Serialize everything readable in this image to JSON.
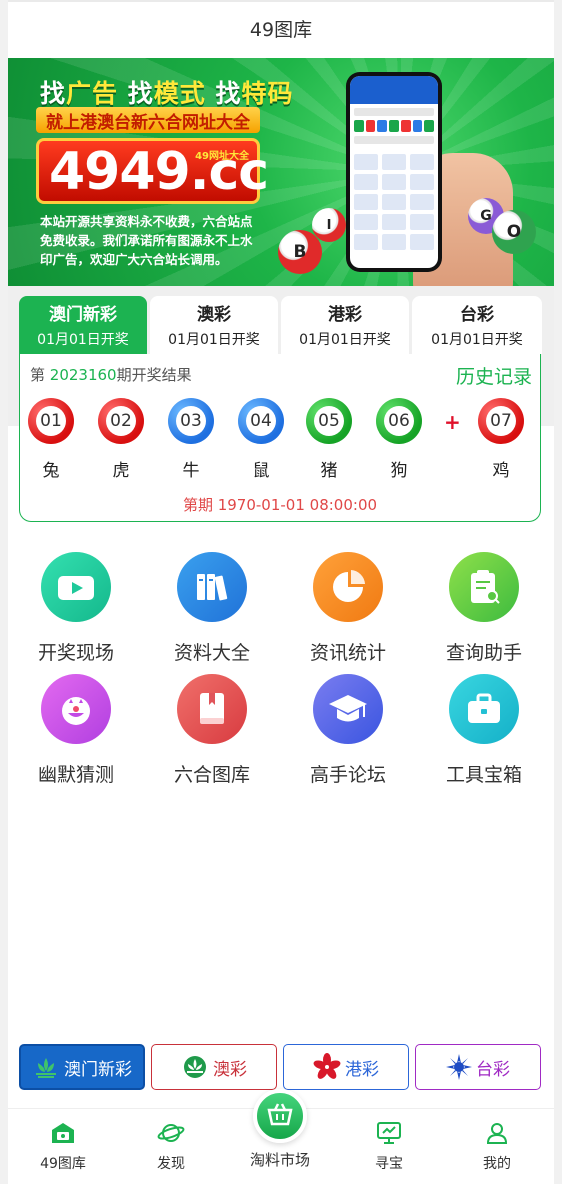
{
  "header": {
    "title": "49图库"
  },
  "banner": {
    "headline_1": "找",
    "headline_2": "广告",
    "headline_3": " 找",
    "headline_4": "模式",
    "headline_5": " 找",
    "headline_6": "特码",
    "strip": "就上港澳台新六合网址大全",
    "domain": "4949.cc",
    "domain_tag": "49网址大全",
    "desc": "本站开源共享资料永不收费，六合站点免费收录。我们承诺所有图源永不上水印广告，欢迎广大六合站长调用。",
    "balls": [
      "B",
      "I",
      "G",
      "O"
    ]
  },
  "tabs": [
    {
      "name": "澳门新彩",
      "date": "01月01日开奖",
      "active": true
    },
    {
      "name": "澳彩",
      "date": "01月01日开奖",
      "active": false
    },
    {
      "name": "港彩",
      "date": "01月01日开奖",
      "active": false
    },
    {
      "name": "台彩",
      "date": "01月01日开奖",
      "active": false
    }
  ],
  "result": {
    "prefix": "第 ",
    "issue": "2023160",
    "suffix": "期开奖结果",
    "history": "历史记录",
    "balls": [
      {
        "num": "01",
        "zodiac": "兔",
        "color": "red"
      },
      {
        "num": "02",
        "zodiac": "虎",
        "color": "red"
      },
      {
        "num": "03",
        "zodiac": "牛",
        "color": "blue"
      },
      {
        "num": "04",
        "zodiac": "鼠",
        "color": "blue"
      },
      {
        "num": "05",
        "zodiac": "猪",
        "color": "green"
      },
      {
        "num": "06",
        "zodiac": "狗",
        "color": "green"
      }
    ],
    "plus": "+",
    "special": {
      "num": "07",
      "zodiac": "鸡",
      "color": "red"
    },
    "period": "第期 1970-01-01 08:00:00"
  },
  "menu": [
    {
      "label": "开奖现场",
      "icon": "video-camera-icon"
    },
    {
      "label": "资料大全",
      "icon": "books-icon"
    },
    {
      "label": "资讯统计",
      "icon": "pie-chart-icon"
    },
    {
      "label": "查询助手",
      "icon": "clipboard-search-icon"
    },
    {
      "label": "幽默猜测",
      "icon": "clown-face-icon"
    },
    {
      "label": "六合图库",
      "icon": "bookmark-book-icon"
    },
    {
      "label": "高手论坛",
      "icon": "graduation-cap-icon"
    },
    {
      "label": "工具宝箱",
      "icon": "briefcase-icon"
    }
  ],
  "lottery_buttons": [
    {
      "label": "澳门新彩",
      "style": "filled"
    },
    {
      "label": "澳彩",
      "style": "red"
    },
    {
      "label": "港彩",
      "style": "blue"
    },
    {
      "label": "台彩",
      "style": "purple"
    }
  ],
  "bottom_nav": [
    {
      "label": "49图库",
      "icon": "gallery-home-icon"
    },
    {
      "label": "发现",
      "icon": "planet-icon"
    },
    {
      "label": "淘料市场",
      "icon": "shopping-basket-icon"
    },
    {
      "label": "寻宝",
      "icon": "monitor-icon"
    },
    {
      "label": "我的",
      "icon": "user-icon"
    }
  ],
  "colors": {
    "primary": "#1cb351",
    "red": "#e0112b",
    "blue": "#1e6fe0",
    "purple": "#a02ac4"
  }
}
